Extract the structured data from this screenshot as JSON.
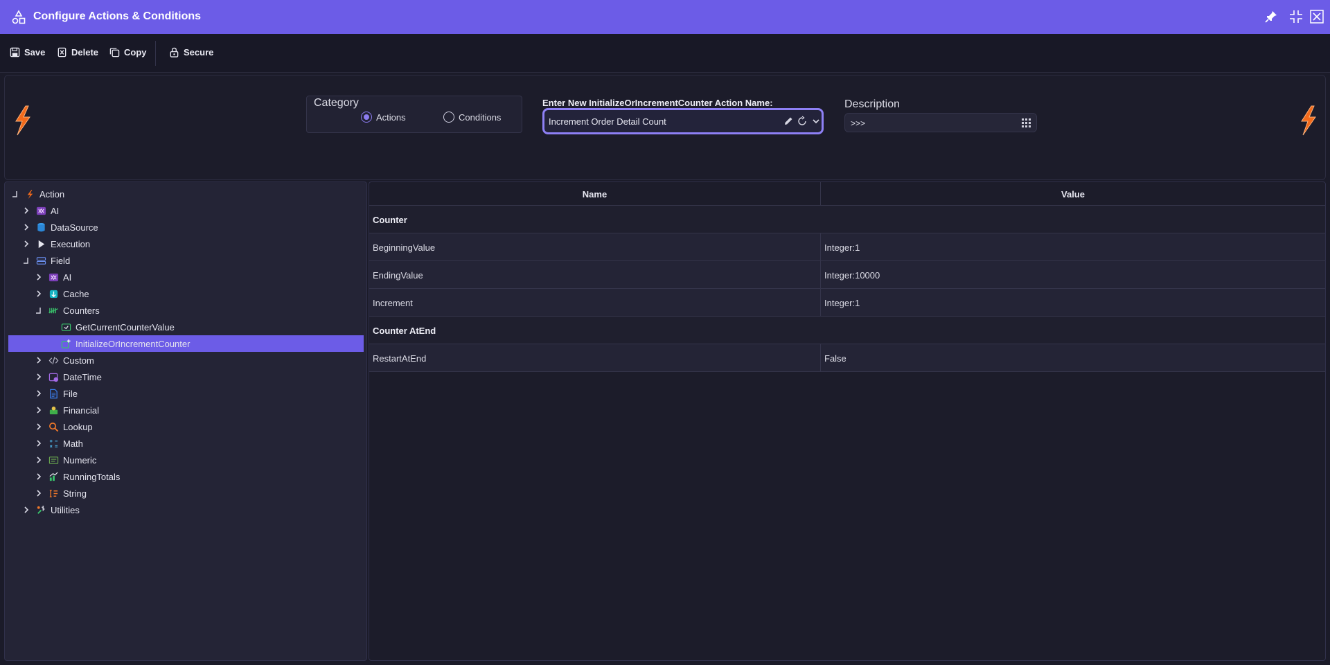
{
  "window": {
    "title": "Configure Actions & Conditions"
  },
  "toolbar": {
    "save_label": "Save",
    "delete_label": "Delete",
    "copy_label": "Copy",
    "secure_label": "Secure"
  },
  "header": {
    "category_label": "Category",
    "category_options": [
      "Actions",
      "Conditions"
    ],
    "category_selected": "Actions",
    "name_label": "Enter New InitializeOrIncrementCounter Action Name:",
    "name_value": "Increment Order Detail Count",
    "description_label": "Description",
    "description_value": ">>>"
  },
  "tree": {
    "items": [
      {
        "label": "Action",
        "level": 0,
        "expanded": true,
        "icon": "bolt-icon"
      },
      {
        "label": "AI",
        "level": 1,
        "expanded": false,
        "icon": "ai-icon"
      },
      {
        "label": "DataSource",
        "level": 1,
        "expanded": false,
        "icon": "database-icon"
      },
      {
        "label": "Execution",
        "level": 1,
        "expanded": false,
        "icon": "play-icon"
      },
      {
        "label": "Field",
        "level": 1,
        "expanded": true,
        "icon": "field-icon"
      },
      {
        "label": "AI",
        "level": 2,
        "expanded": false,
        "icon": "ai-icon"
      },
      {
        "label": "Cache",
        "level": 2,
        "expanded": false,
        "icon": "cache-icon"
      },
      {
        "label": "Counters",
        "level": 2,
        "expanded": true,
        "icon": "counter-icon"
      },
      {
        "label": "GetCurrentCounterValue",
        "level": 3,
        "leaf": true,
        "icon": "get-counter-icon"
      },
      {
        "label": "InitializeOrIncrementCounter",
        "level": 3,
        "leaf": true,
        "selected": true,
        "icon": "increment-counter-icon"
      },
      {
        "label": "Custom",
        "level": 2,
        "expanded": false,
        "icon": "code-icon"
      },
      {
        "label": "DateTime",
        "level": 2,
        "expanded": false,
        "icon": "calendar-icon"
      },
      {
        "label": "File",
        "level": 2,
        "expanded": false,
        "icon": "file-icon"
      },
      {
        "label": "Financial",
        "level": 2,
        "expanded": false,
        "icon": "money-icon"
      },
      {
        "label": "Lookup",
        "level": 2,
        "expanded": false,
        "icon": "search-icon"
      },
      {
        "label": "Math",
        "level": 2,
        "expanded": false,
        "icon": "math-icon"
      },
      {
        "label": "Numeric",
        "level": 2,
        "expanded": false,
        "icon": "numeric-icon"
      },
      {
        "label": "RunningTotals",
        "level": 2,
        "expanded": false,
        "icon": "chart-icon"
      },
      {
        "label": "String",
        "level": 2,
        "expanded": false,
        "icon": "string-icon"
      },
      {
        "label": "Utilities",
        "level": 1,
        "expanded": false,
        "icon": "tools-icon"
      }
    ]
  },
  "grid": {
    "header_name": "Name",
    "header_value": "Value",
    "rows": [
      {
        "type": "group",
        "name": "Counter"
      },
      {
        "type": "prop",
        "name": "BeginningValue",
        "value": "Integer:1"
      },
      {
        "type": "prop",
        "name": "EndingValue",
        "value": "Integer:10000"
      },
      {
        "type": "prop",
        "name": "Increment",
        "value": "Integer:1"
      },
      {
        "type": "group",
        "name": "Counter AtEnd"
      },
      {
        "type": "prop",
        "name": "RestartAtEnd",
        "value": "False"
      }
    ]
  },
  "colors": {
    "accent": "#6c5ce7",
    "focus_border": "#8e80f5",
    "bolt": "#f26a1b",
    "background": "#1b1b29"
  }
}
